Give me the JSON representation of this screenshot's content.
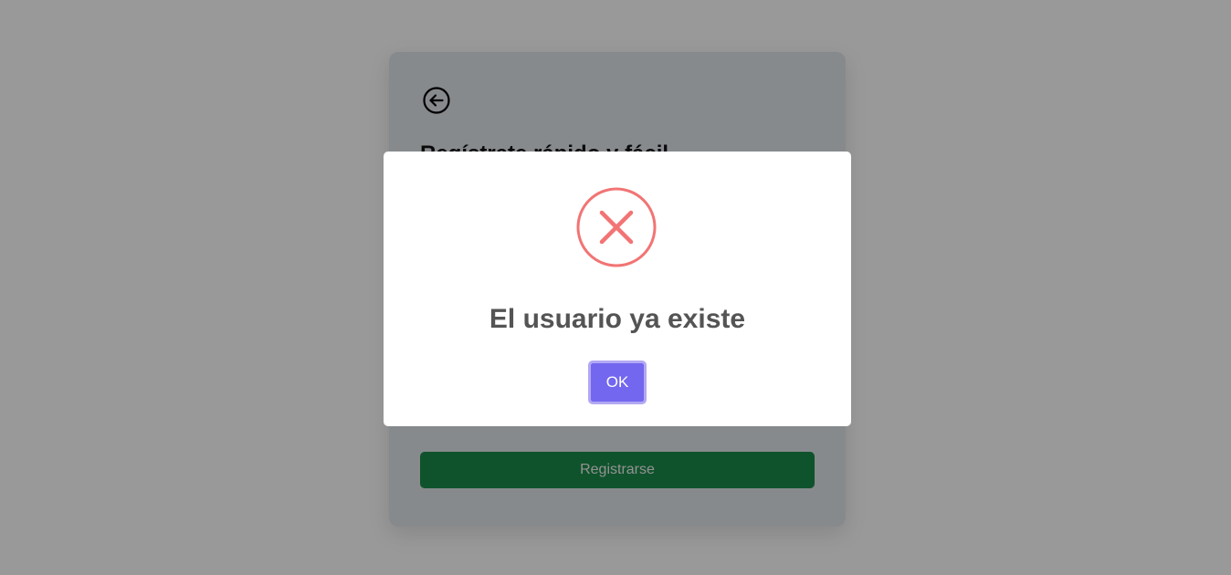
{
  "page": {
    "title": "Regístrate rápido y fácil",
    "register_label": "Registrarse"
  },
  "modal": {
    "icon": "error-x-icon",
    "title": "El usuario ya existe",
    "ok_label": "OK"
  },
  "colors": {
    "error": "#f27474",
    "confirm": "#7367f0",
    "register": "#198a4a"
  }
}
